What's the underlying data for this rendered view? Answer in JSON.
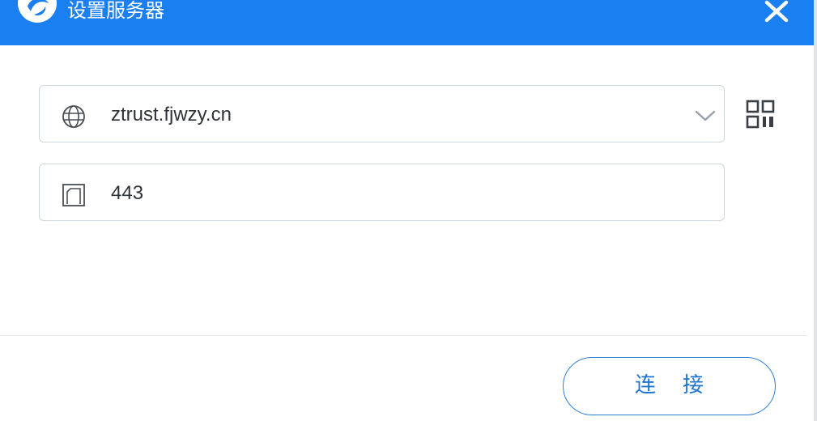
{
  "window": {
    "title": "设置服务器",
    "close_icon": "close-icon",
    "logo_icon": "app-logo-icon",
    "accent_color": "#1a7ff0"
  },
  "server": {
    "host_value": "ztrust.fjwzy.cn",
    "host_icon": "globe-icon",
    "dropdown_icon": "chevron-down-icon",
    "qr_icon": "qr-code-icon",
    "port_value": "443",
    "port_icon": "port-icon"
  },
  "footer": {
    "connect_label": "连    接",
    "button_color": "#2d7fd6"
  }
}
